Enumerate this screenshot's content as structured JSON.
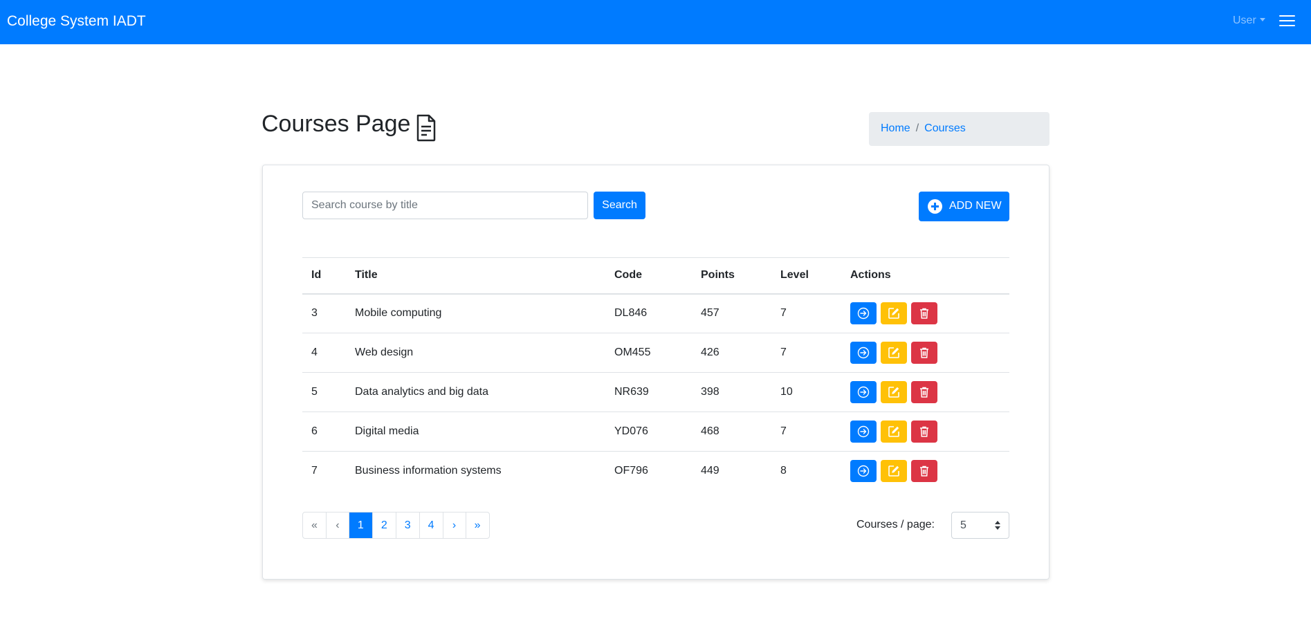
{
  "navbar": {
    "brand": "College System IADT",
    "user_label": "User",
    "menu_icon": "hamburger-icon",
    "background": "#007bff"
  },
  "page": {
    "title": "Courses Page",
    "title_icon": "document-icon"
  },
  "breadcrumb": {
    "items": [
      "Home",
      "Courses"
    ],
    "separator": "/"
  },
  "search": {
    "placeholder": "Search course by title",
    "value": "",
    "button_label": "Search"
  },
  "add_button": {
    "label": "ADD NEW",
    "icon": "plus-circle-icon"
  },
  "table": {
    "headers": [
      "Id",
      "Title",
      "Code",
      "Points",
      "Level",
      "Actions"
    ],
    "rows": [
      {
        "id": "3",
        "title": "Mobile computing",
        "code": "DL846",
        "points": "457",
        "level": "7"
      },
      {
        "id": "4",
        "title": "Web design",
        "code": "OM455",
        "points": "426",
        "level": "7"
      },
      {
        "id": "5",
        "title": "Data analytics and big data",
        "code": "NR639",
        "points": "398",
        "level": "10"
      },
      {
        "id": "6",
        "title": "Digital media",
        "code": "YD076",
        "points": "468",
        "level": "7"
      },
      {
        "id": "7",
        "title": "Business information systems",
        "code": "OF796",
        "points": "449",
        "level": "8"
      }
    ],
    "action_icons": [
      "arrow-right-circle-icon",
      "edit-icon",
      "trash-icon"
    ],
    "action_colors": {
      "view": "#007bff",
      "edit": "#ffc107",
      "delete": "#dc3545"
    }
  },
  "pagination": {
    "first": "«",
    "prev": "‹",
    "pages": [
      "1",
      "2",
      "3",
      "4"
    ],
    "active_page": "1",
    "next": "›",
    "last": "»"
  },
  "per_page": {
    "label": "Courses / page:",
    "value": "5"
  }
}
